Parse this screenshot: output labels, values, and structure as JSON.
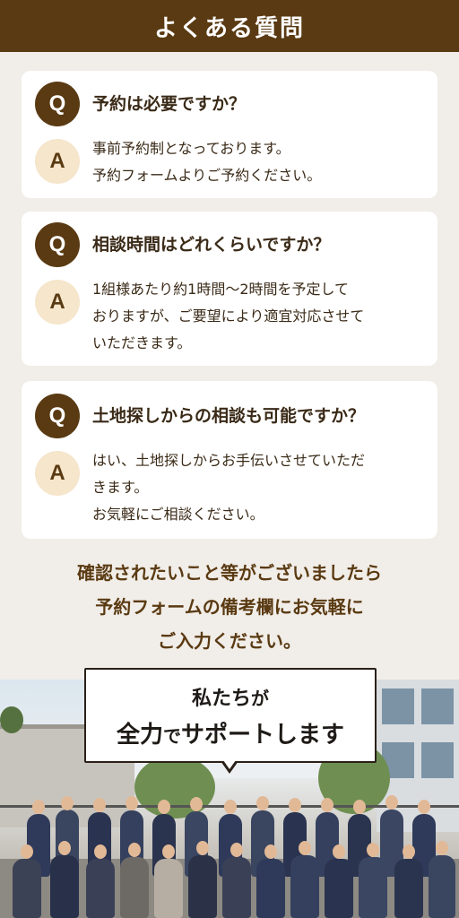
{
  "header": {
    "title": "よくある質問"
  },
  "faq": [
    {
      "q_badge": "Q",
      "question": "予約は必要ですか？",
      "a_badge": "A",
      "answer_lines": [
        "事前予約制となっております。",
        "予約フォームよりご予約ください。"
      ]
    },
    {
      "q_badge": "Q",
      "question": "相談時間はどれくらいですか？",
      "a_badge": "A",
      "answer_lines": [
        "1組様あたり約1時間〜2時間を予定して",
        "おりますが、ご要望により適宜対応させて",
        "いただきます。"
      ]
    },
    {
      "q_badge": "Q",
      "question": "土地探しからの相談も可能ですか？",
      "a_badge": "A",
      "answer_lines": [
        "はい、土地探しからお手伝いさせていただ",
        "きます。",
        "お気軽にご相談ください。"
      ]
    }
  ],
  "closing": {
    "lines": [
      "確認されたいこと等がございましたら",
      "予約フォームの備考欄にお気軽に",
      "ご入力ください。"
    ]
  },
  "banner": {
    "line1_a": "私たち",
    "line1_b": "が",
    "line2_a": "全力",
    "line2_b": "で",
    "line2_c": "サポート",
    "line2_d": "します"
  },
  "colors": {
    "brand_brown": "#5a3a12",
    "answer_badge_bg": "#f5e6cc",
    "page_bg": "#f1ede8",
    "highlight": "#f2b15a"
  }
}
